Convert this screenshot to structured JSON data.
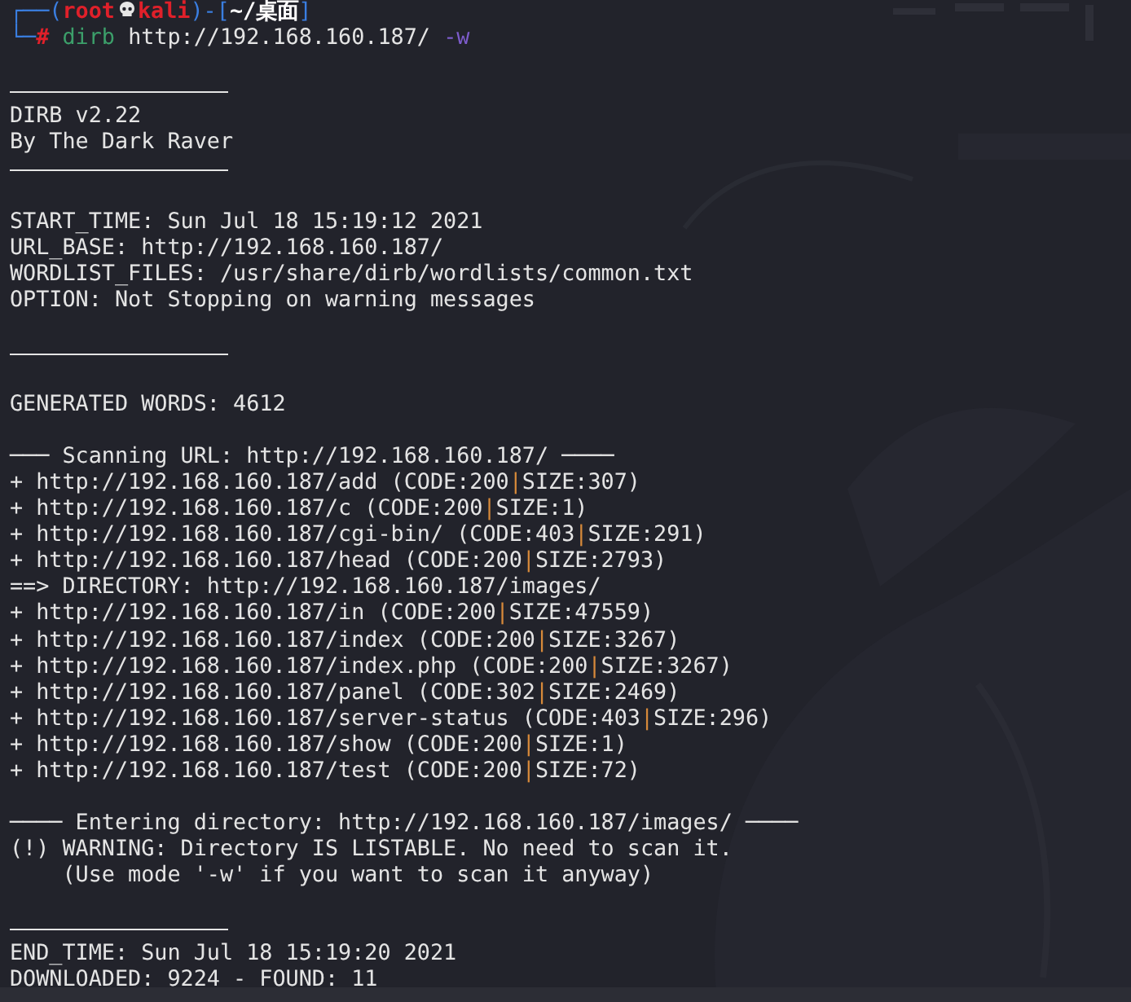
{
  "prompt": {
    "frame_open": "┌──(",
    "user": "root",
    "host": "kali",
    "frame_mid": ")-[",
    "cwd": "~/桌面",
    "frame_close": "]",
    "frame_corner": "└─",
    "symbol": "#",
    "command": "dirb",
    "argument": "http://192.168.160.187/",
    "flag": "-w"
  },
  "output": [
    {
      "kind": "blank"
    },
    {
      "kind": "rule"
    },
    {
      "kind": "text",
      "text": "DIRB v2.22"
    },
    {
      "kind": "text",
      "text": "By The Dark Raver"
    },
    {
      "kind": "rule"
    },
    {
      "kind": "blank"
    },
    {
      "kind": "text",
      "text": "START_TIME: Sun Jul 18 15:19:12 2021"
    },
    {
      "kind": "text",
      "text": "URL_BASE: http://192.168.160.187/"
    },
    {
      "kind": "text",
      "text": "WORDLIST_FILES: /usr/share/dirb/wordlists/common.txt"
    },
    {
      "kind": "text",
      "text": "OPTION: Not Stopping on warning messages"
    },
    {
      "kind": "blank"
    },
    {
      "kind": "rule"
    },
    {
      "kind": "blank"
    },
    {
      "kind": "text",
      "text": "GENERATED WORDS: 4612"
    },
    {
      "kind": "blank"
    },
    {
      "kind": "text",
      "text": "─── Scanning URL: http://192.168.160.187/ ────"
    },
    {
      "kind": "text",
      "text": "+ http://192.168.160.187/add (CODE:200|SIZE:307)"
    },
    {
      "kind": "text",
      "text": "+ http://192.168.160.187/c (CODE:200|SIZE:1)"
    },
    {
      "kind": "text",
      "text": "+ http://192.168.160.187/cgi-bin/ (CODE:403|SIZE:291)"
    },
    {
      "kind": "text",
      "text": "+ http://192.168.160.187/head (CODE:200|SIZE:2793)"
    },
    {
      "kind": "text",
      "text": "==> DIRECTORY: http://192.168.160.187/images/"
    },
    {
      "kind": "text",
      "text": "+ http://192.168.160.187/in (CODE:200|SIZE:47559)"
    },
    {
      "kind": "text",
      "text": "+ http://192.168.160.187/index (CODE:200|SIZE:3267)"
    },
    {
      "kind": "text",
      "text": "+ http://192.168.160.187/index.php (CODE:200|SIZE:3267)"
    },
    {
      "kind": "text",
      "text": "+ http://192.168.160.187/panel (CODE:302|SIZE:2469)"
    },
    {
      "kind": "text",
      "text": "+ http://192.168.160.187/server-status (CODE:403|SIZE:296)"
    },
    {
      "kind": "text",
      "text": "+ http://192.168.160.187/show (CODE:200|SIZE:1)"
    },
    {
      "kind": "text",
      "text": "+ http://192.168.160.187/test (CODE:200|SIZE:72)"
    },
    {
      "kind": "blank"
    },
    {
      "kind": "text",
      "text": "──── Entering directory: http://192.168.160.187/images/ ────"
    },
    {
      "kind": "text",
      "text": "(!) WARNING: Directory IS LISTABLE. No need to scan it."
    },
    {
      "kind": "text",
      "text": "    (Use mode '-w' if you want to scan it anyway)"
    },
    {
      "kind": "blank"
    },
    {
      "kind": "rule"
    },
    {
      "kind": "text",
      "text": "END_TIME: Sun Jul 18 15:19:20 2021"
    },
    {
      "kind": "text",
      "text": "DOWNLOADED: 9224 - FOUND: 11"
    }
  ]
}
